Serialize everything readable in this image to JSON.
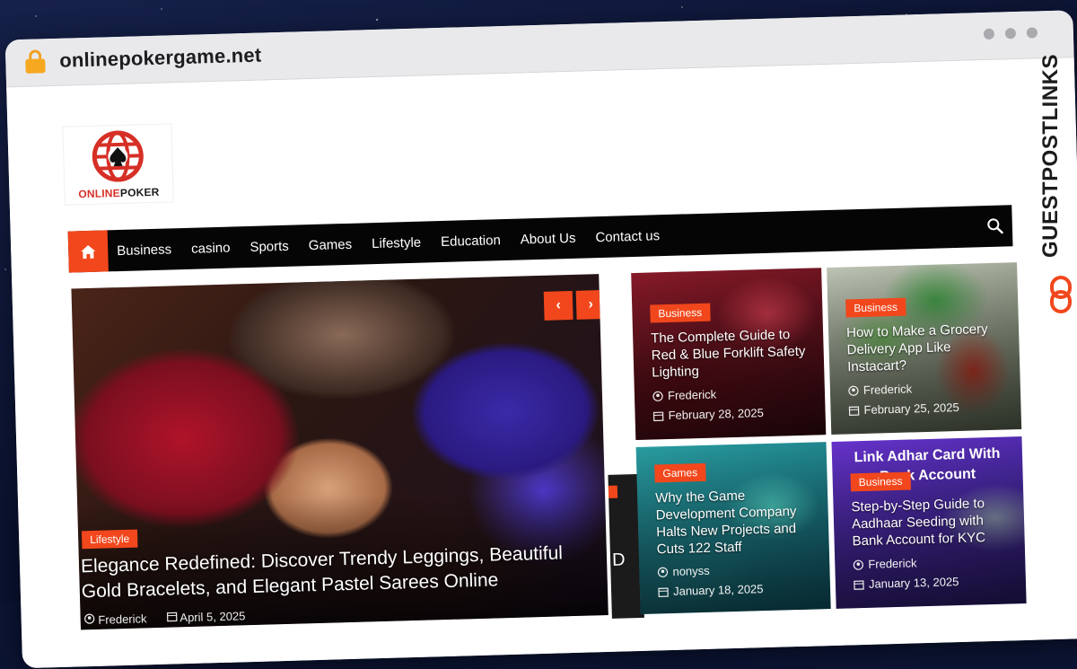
{
  "browser": {
    "url": "onlinepokergame.net"
  },
  "logo": {
    "text_part1": "ONLINE",
    "text_part2": "POKER"
  },
  "nav": {
    "items": [
      "Business",
      "casino",
      "Sports",
      "Games",
      "Lifestyle",
      "Education",
      "About Us",
      "Contact us"
    ]
  },
  "hero": {
    "category": "Lifestyle",
    "title": "Elegance Redefined: Discover Trendy Leggings, Beautiful Gold Bracelets, and Elegant Pastel Sarees Online",
    "author": "Frederick",
    "date": "April 5, 2025",
    "prev_label": "‹",
    "next_label": "›"
  },
  "peek": {
    "title_fragment": "D"
  },
  "cards": [
    {
      "category": "Business",
      "title": "The Complete Guide to Red & Blue Forklift Safety Lighting",
      "author": "Frederick",
      "date": "February 28, 2025"
    },
    {
      "category": "Business",
      "title": "How to Make a Grocery Delivery App Like Instacart?",
      "author": "Frederick",
      "date": "February 25, 2025"
    },
    {
      "category": "Games",
      "title": "Why the Game Development Company Halts New Projects and Cuts 122 Staff",
      "author": "nonyss",
      "date": "January 18, 2025"
    },
    {
      "category": "Business",
      "title": "Step-by-Step Guide to Aadhaar Seeding with Bank Account for KYC",
      "author": "Frederick",
      "date": "January 13, 2025",
      "image_text": "Link Adhar Card With Bank Account"
    }
  ],
  "sidebar_badge": {
    "label": "GUESTPOSTLINKS"
  },
  "colors": {
    "accent": "#f2471c",
    "nav_bg": "#050505",
    "logo_red": "#d62f26"
  }
}
